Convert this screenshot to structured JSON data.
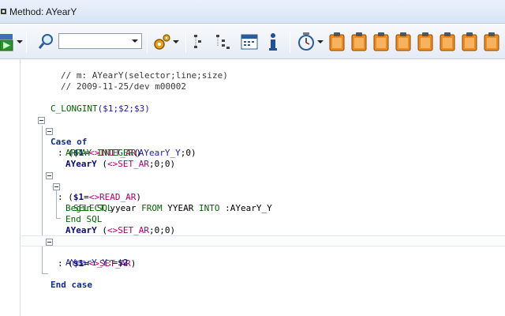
{
  "window": {
    "title": "Method: AYearY"
  },
  "toolbar": {
    "run_label": "",
    "combo_value": ""
  },
  "code": {
    "comment1": "// m: AYearY(selector;line;size)",
    "comment2": "// 2009-11-25/dev m00002",
    "longint_cmd": "C_LONGINT",
    "longint_args": "($1;$2;$3)",
    "case_of": "Case of",
    "case1_colon": ": (",
    "case1_var": "$1",
    "case1_op": "=",
    "case1_const": "<>INIT_AR",
    "case1_close": ")",
    "array_cmd": "ARRAY INTEGER",
    "array_open": "(",
    "array_var": "AYearY_Y",
    "array_rest": ";0)",
    "method1": "AYearY",
    "method1_open": " (",
    "method1_const": "<>SET_AR",
    "method1_rest": ";0;0)",
    "case2_colon": ": (",
    "case2_var": "$1",
    "case2_op": "=",
    "case2_const": "<>READ_AR",
    "case2_close": ")",
    "begin_sql": "Begin SQL",
    "sql_select": "SELECT",
    "sql_mid1": " yyear ",
    "sql_from": "FROM",
    "sql_mid2": " YYEAR ",
    "sql_into": "INTO",
    "sql_target": " :AYearY_Y",
    "end_sql": "End SQL",
    "method2": "AYearY",
    "method2_open": " (",
    "method2_const": "<>SET_AR",
    "method2_rest": ";0;0)",
    "case3_colon": ": (",
    "case3_var": "$1",
    "case3_op": "=",
    "case3_const": "<>SET_AR",
    "case3_close": ")",
    "assign_var": "AYearY_Y",
    "assign_op": ":=",
    "assign_val": "$2",
    "end_case": "End case"
  },
  "icons": [
    "run-icon",
    "search-icon",
    "gear-icon",
    "tree-icon",
    "outline-icon",
    "calendar-icon",
    "info-icon",
    "clock-icon",
    "clipboard-icon"
  ],
  "colors": {
    "accent": "#0b2e8a",
    "comment": "#3a3a3a",
    "command": "#006400",
    "constant": "#b0006a",
    "variable": "#1a1aaa"
  }
}
